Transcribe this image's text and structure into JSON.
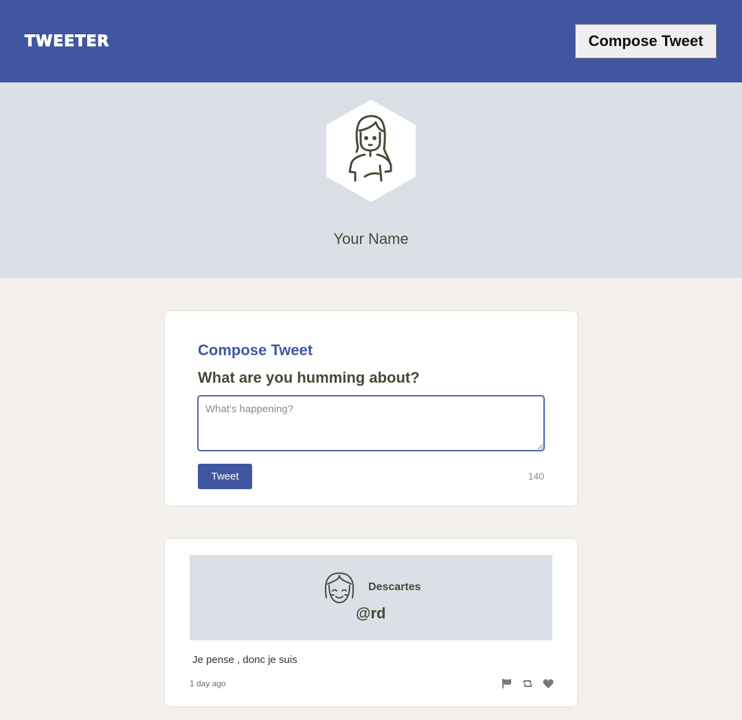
{
  "navbar": {
    "brand": "TWEETER",
    "compose_button": "Compose Tweet"
  },
  "profile": {
    "name": "Your Name",
    "avatar_icon": "woman-avatar-icon"
  },
  "compose": {
    "title": "Compose Tweet",
    "question": "What are you humming about?",
    "placeholder": "What's happening?",
    "submit_label": "Tweet",
    "counter": "140"
  },
  "tweets": [
    {
      "author": "Descartes",
      "handle": "@rd",
      "text": "Je pense , donc je suis",
      "time": "1 day ago",
      "avatar_icon": "smiling-face-avatar-icon",
      "actions": [
        "flag-icon",
        "retweet-icon",
        "heart-icon"
      ]
    }
  ],
  "colors": {
    "primary": "#4056a1",
    "background": "#f4f1ec",
    "profile_bg": "#dbe0e7",
    "text": "#4a4637"
  }
}
